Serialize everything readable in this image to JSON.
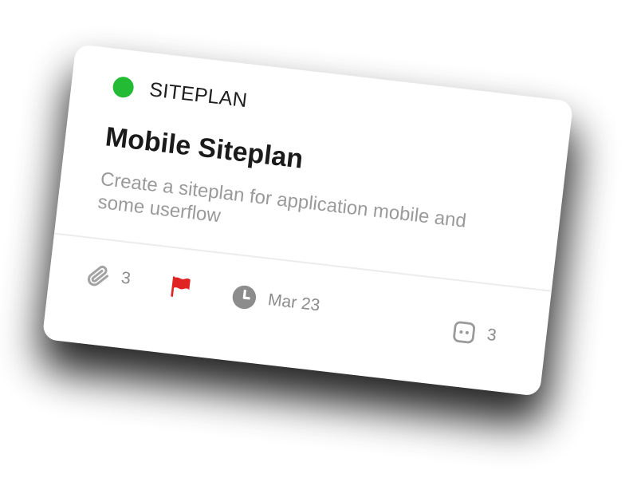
{
  "card": {
    "status_color": "#22bb33",
    "category": "SITEPLAN",
    "title": "Mobile Siteplan",
    "description": "Create a siteplan for application mobile and some userflow",
    "attachments": {
      "icon": "paperclip-icon",
      "count": "3"
    },
    "priority": {
      "icon": "flag-icon",
      "color": "#e02424"
    },
    "due": {
      "icon": "clock-icon",
      "label": "Mar 23"
    },
    "comments": {
      "icon": "comment-icon",
      "count": "3"
    }
  }
}
